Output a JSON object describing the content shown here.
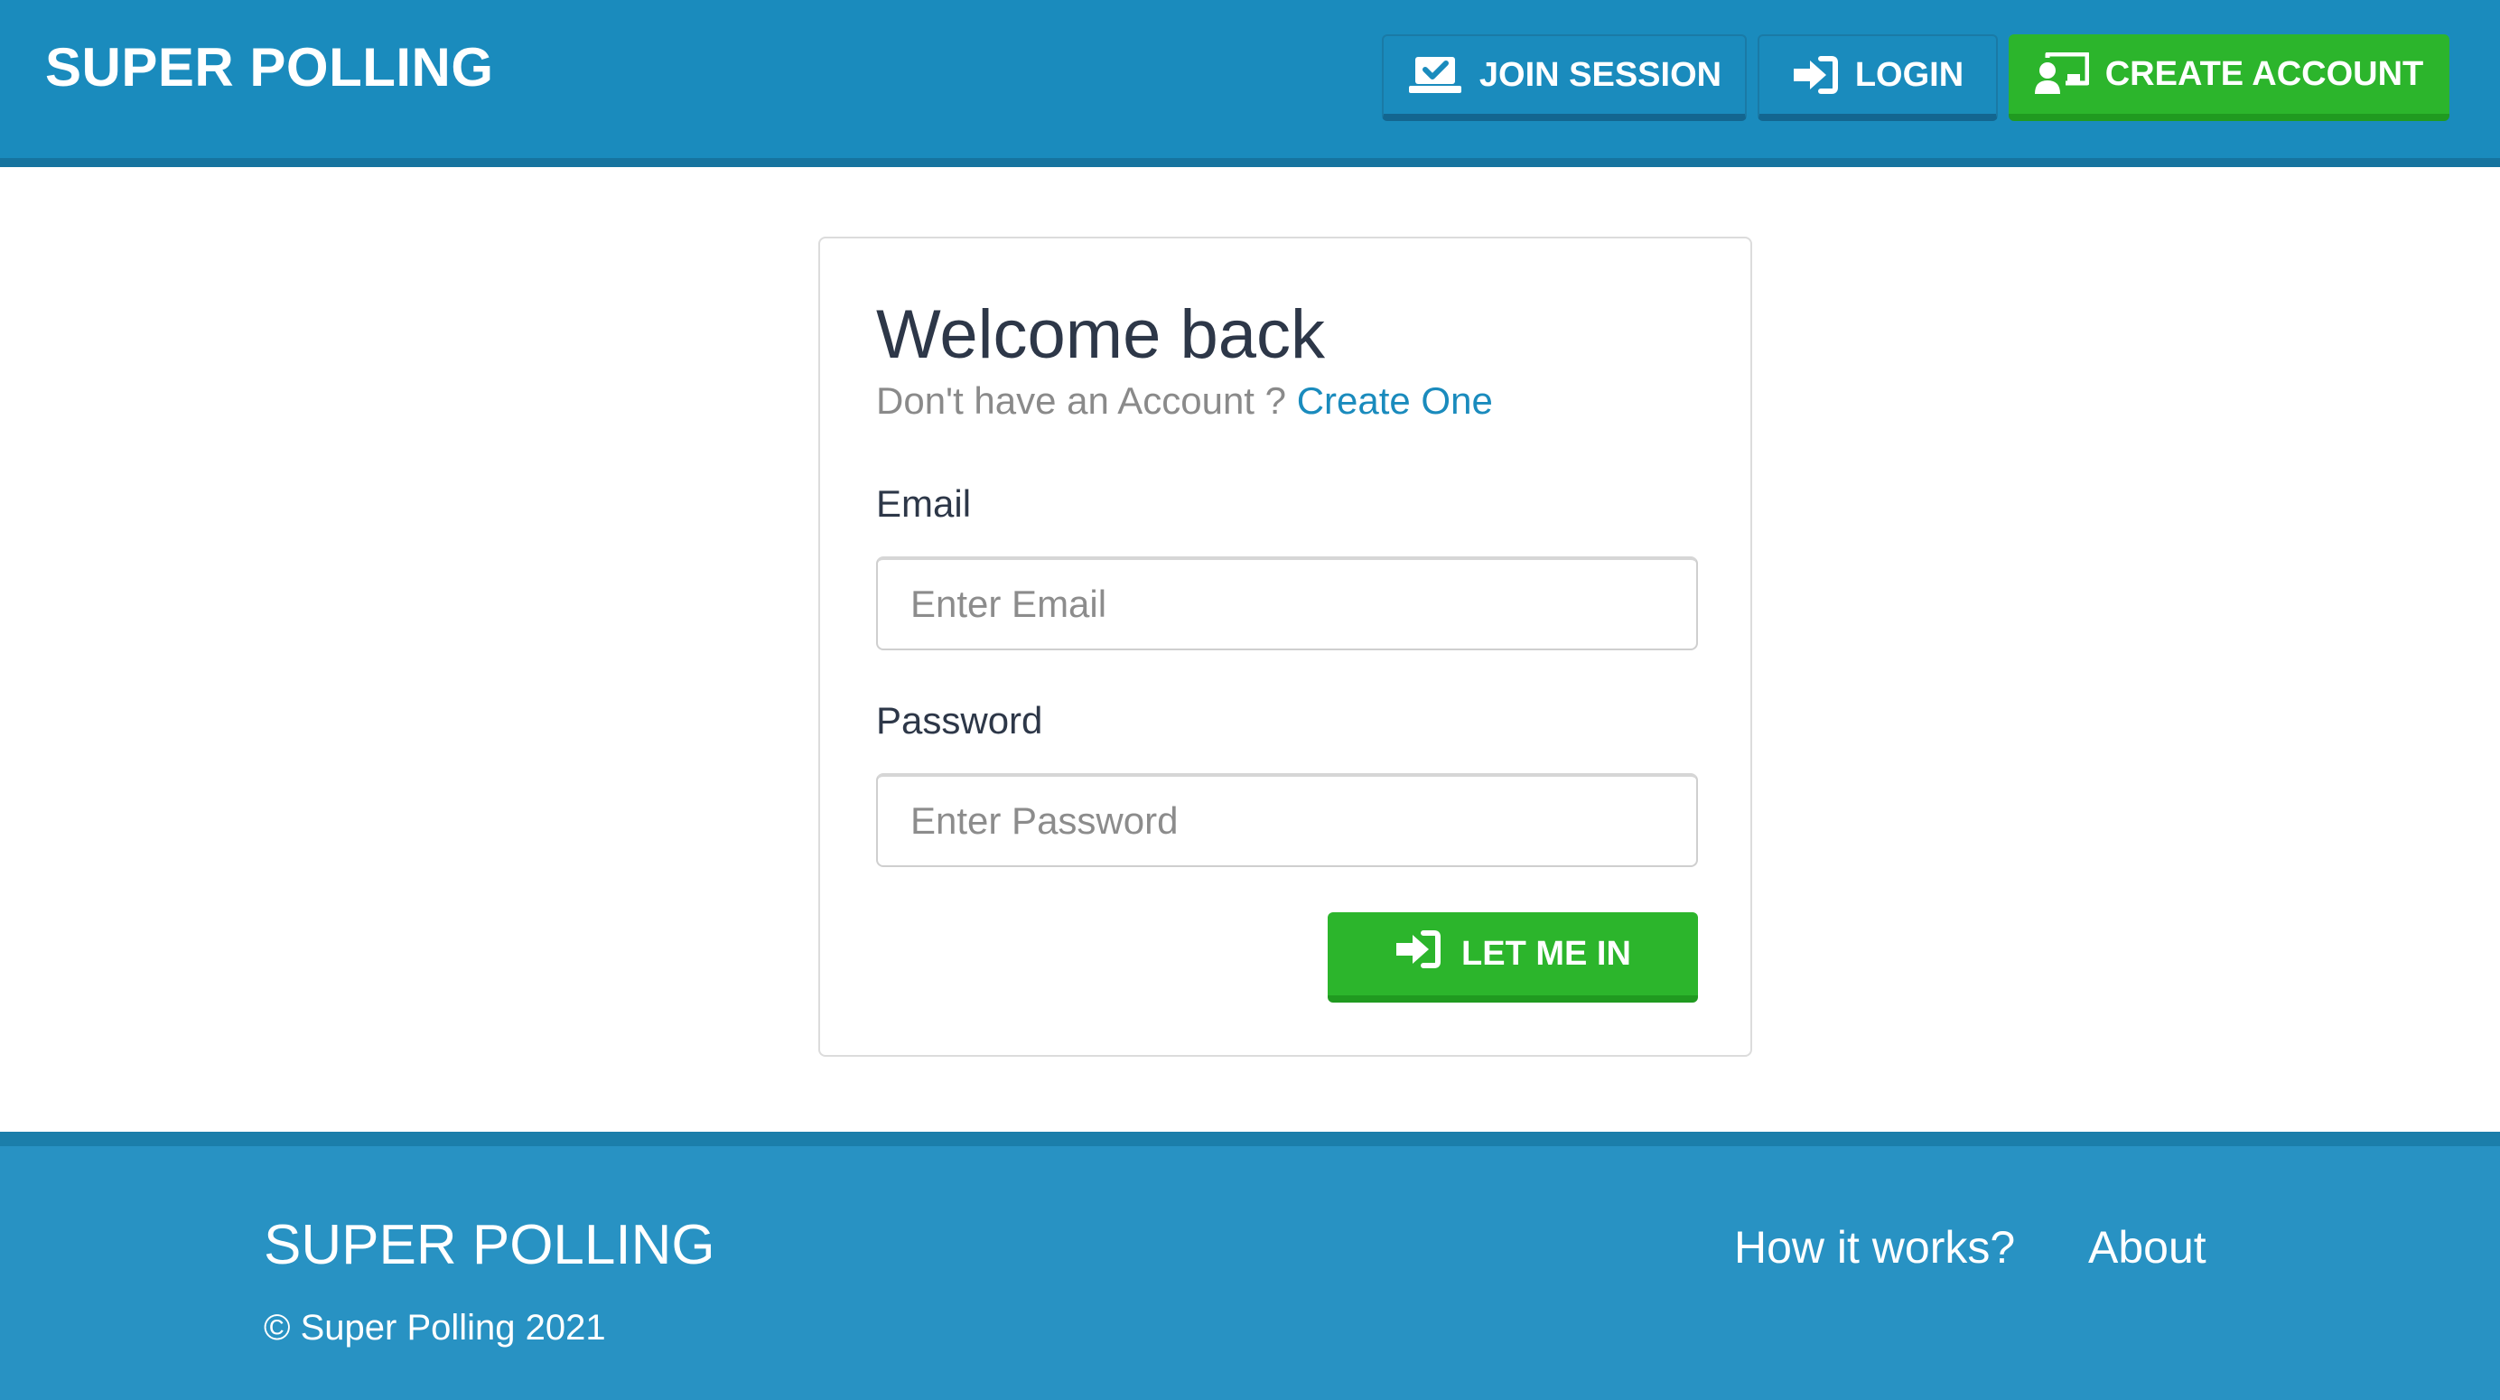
{
  "header": {
    "brand": "SUPER POLLING",
    "buttons": {
      "join_session": "JOIN SESSION",
      "login": "LOGIN",
      "create_account": "CREATE ACCOUNT"
    }
  },
  "login_form": {
    "title": "Welcome back",
    "prompt": "Don't have an Account ?",
    "create_link": "Create One",
    "email_label": "Email",
    "email_placeholder": "Enter Email",
    "email_value": "",
    "password_label": "Password",
    "password_placeholder": "Enter Password",
    "password_value": "",
    "submit_label": "LET ME IN"
  },
  "footer": {
    "brand": "SUPER POLLING",
    "copyright": "© Super Polling 2021",
    "links": {
      "how_it_works": "How it works?",
      "about": "About"
    }
  },
  "icons": {
    "join_session": "laptop-check-icon",
    "login": "sign-in-icon",
    "create_account": "chalkboard-user-icon",
    "submit": "sign-in-icon"
  },
  "colors": {
    "primary": "#1a8bbd",
    "primary_dark": "#16749f",
    "success": "#2cb52c",
    "footer": "#2892c3",
    "link": "#1a8bbd",
    "text": "#2d3748",
    "muted": "#8a8a8a"
  }
}
